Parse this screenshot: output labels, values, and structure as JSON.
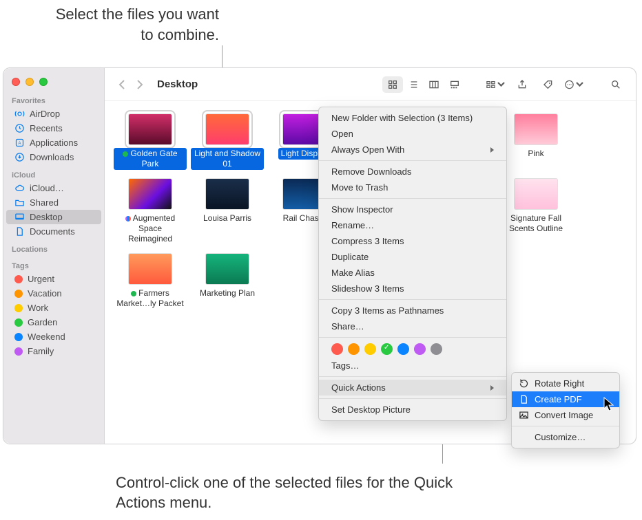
{
  "callouts": {
    "top": "Select the files you want to combine.",
    "bottom": "Control-click one of the selected files for the Quick Actions menu."
  },
  "toolbar": {
    "title": "Desktop"
  },
  "sidebar": {
    "favorites_header": "Favorites",
    "icloud_header": "iCloud",
    "locations_header": "Locations",
    "tags_header": "Tags",
    "favorites": [
      {
        "label": "AirDrop"
      },
      {
        "label": "Recents"
      },
      {
        "label": "Applications"
      },
      {
        "label": "Downloads"
      }
    ],
    "icloud": [
      {
        "label": "iCloud…"
      },
      {
        "label": "Shared"
      },
      {
        "label": "Desktop"
      },
      {
        "label": "Documents"
      }
    ],
    "tags": [
      {
        "label": "Urgent",
        "color": "red"
      },
      {
        "label": "Vacation",
        "color": "orange"
      },
      {
        "label": "Work",
        "color": "yellow"
      },
      {
        "label": "Garden",
        "color": "green"
      },
      {
        "label": "Weekend",
        "color": "blue"
      },
      {
        "label": "Family",
        "color": "purple"
      }
    ]
  },
  "files": {
    "row1": [
      {
        "label": "Golden Gate Park",
        "selected": true,
        "tag": "green"
      },
      {
        "label": "Light and Shadow 01",
        "selected": true
      },
      {
        "label": "Light Display",
        "selected": true
      },
      {
        "label": "Pink",
        "selected": false
      }
    ],
    "row2": [
      {
        "label": "Augmented Space Reimagined",
        "tag": "multi"
      },
      {
        "label": "Louisa Parris"
      },
      {
        "label": "Rail Chaser"
      },
      {
        "label": "Signature Fall Scents Outline"
      }
    ],
    "row3": [
      {
        "label": "Farmers Market…ly Packet",
        "tag": "green"
      },
      {
        "label": "Marketing Plan"
      }
    ]
  },
  "context_menu": {
    "items": [
      "New Folder with Selection (3 Items)",
      "Open",
      "Always Open With",
      "Remove Downloads",
      "Move to Trash",
      "Show Inspector",
      "Rename…",
      "Compress 3 Items",
      "Duplicate",
      "Make Alias",
      "Slideshow 3 Items",
      "Copy 3 Items as Pathnames",
      "Share…",
      "Tags…",
      "Quick Actions",
      "Set Desktop Picture"
    ]
  },
  "submenu": {
    "rotate": "Rotate Right",
    "create_pdf": "Create PDF",
    "convert": "Convert Image",
    "customize": "Customize…"
  }
}
